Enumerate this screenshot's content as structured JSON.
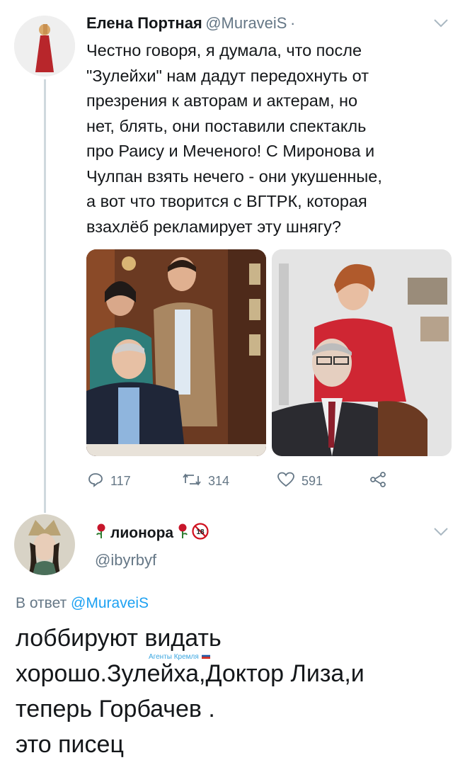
{
  "tweet": {
    "author_name": "Елена Портная",
    "author_handle": "@MuraveiS",
    "dot": "·",
    "lines": [
      "Честно говоря, я думала, что после",
      "\"Зулейхи\" нам дадут передохнуть от",
      "презрения к авторам и актерам, но",
      "нет, блять, они поставили спектакль",
      "про Раису и Меченого! С Миронова и",
      "Чулпан взять нечего - они укушенные,",
      "а вот что творится с ВГТРК, которая",
      "взахлёб рекламирует эту шнягу?"
    ],
    "actions": {
      "replies": "117",
      "retweets": "314",
      "likes": "591"
    }
  },
  "reply": {
    "author_name": "лионора",
    "author_handle": "@ibyrbyf",
    "reply_to_prefix": "В ответ",
    "reply_to_handle": "@MuraveiS",
    "watermark": "Агенты Кремля",
    "lines": [
      "лоббируют  видать",
      "хорошо.Зулейха,Доктор Лиза,и",
      "теперь Горбачев .",
      "это писец"
    ]
  },
  "colors": {
    "link": "#1da1f2",
    "secondary": "#657786",
    "thread_line": "#cfd9de"
  },
  "icons": [
    "chevron-down-icon",
    "reply-icon",
    "retweet-icon",
    "like-icon",
    "share-icon",
    "rose-emoji",
    "eighteen-plus-emoji"
  ]
}
